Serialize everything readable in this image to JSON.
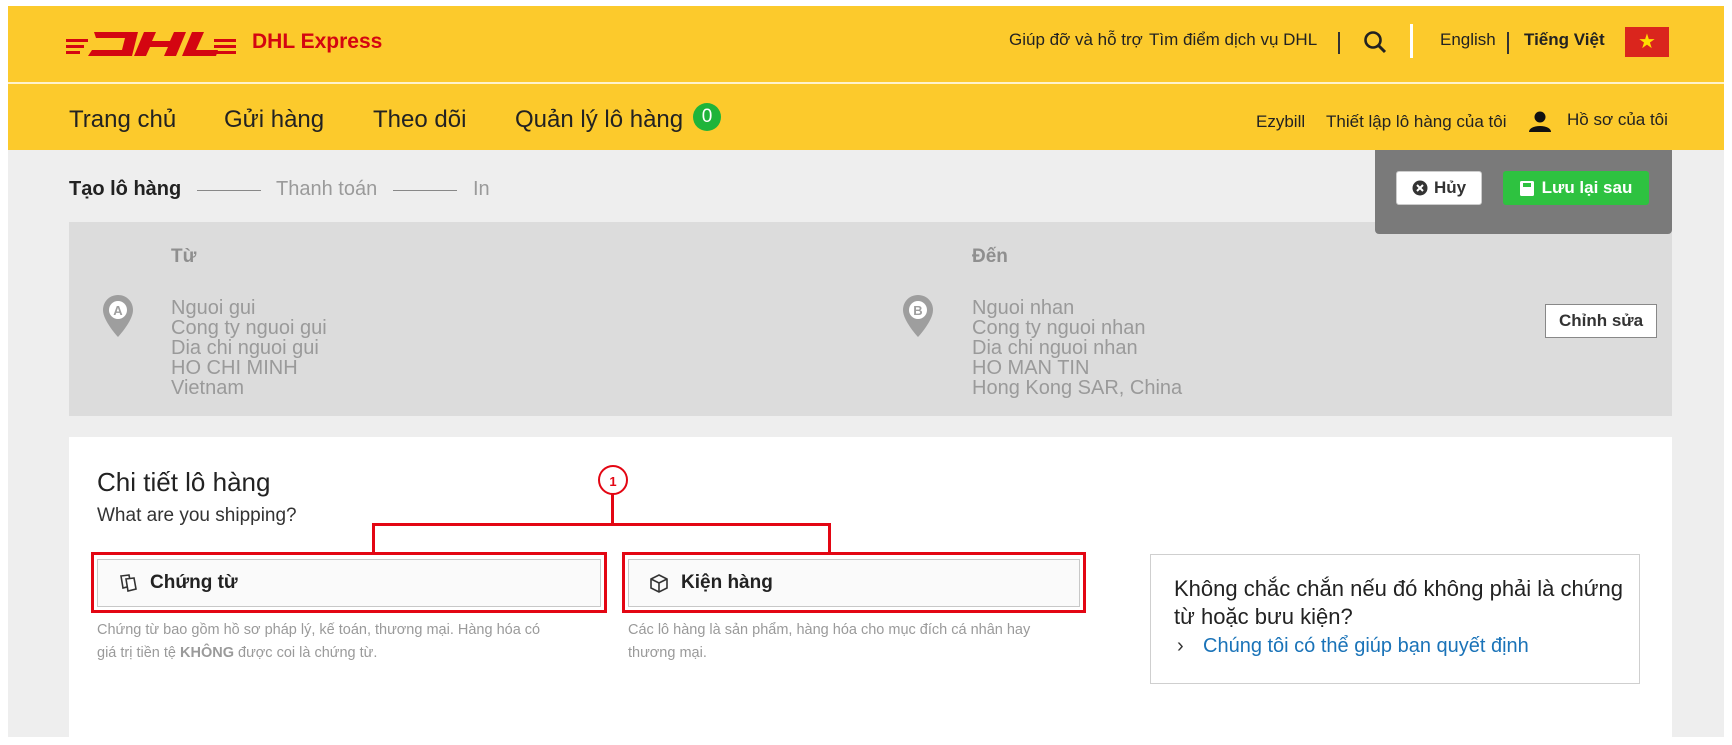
{
  "header": {
    "logo_text": "DHL",
    "brand": "DHL Express",
    "help": "Giúp đỡ và hỗ trợ",
    "find_location": "Tìm điểm dịch vụ DHL",
    "lang_en": "English",
    "lang_vi": "Tiếng Việt",
    "flag_star": "★"
  },
  "nav": {
    "home": "Trang chủ",
    "send": "Gửi hàng",
    "track": "Theo dõi",
    "manage": "Quản lý lô hàng",
    "manage_count": "0",
    "ezybill": "Ezybill",
    "setup": "Thiết lập lô hàng của tôi",
    "profile": "Hồ sơ của tôi"
  },
  "steps": [
    "Tạo lô hàng",
    "Thanh toán",
    "In"
  ],
  "actions": {
    "cancel": "Hủy",
    "save_later": "Lưu lại sau"
  },
  "from": {
    "heading": "Từ",
    "marker": "A",
    "lines": [
      "Nguoi gui",
      "Cong ty nguoi gui",
      "Dia chi nguoi gui",
      "HO CHI MINH",
      "Vietnam"
    ]
  },
  "to": {
    "heading": "Đến",
    "marker": "B",
    "lines": [
      "Nguoi nhan",
      "Cong ty nguoi nhan",
      "Dia chi nguoi nhan",
      "HO MAN TIN",
      "Hong Kong SAR, China"
    ]
  },
  "edit_button": "Chỉnh sửa",
  "details": {
    "title": "Chi tiết lô hàng",
    "subtitle": "What are you shipping?",
    "documents": {
      "label": "Chứng từ",
      "desc_line1": "Chứng từ bao gồm hồ sơ pháp lý, kế toán, thương mại. Hàng hóa có",
      "desc_line2_a": "giá trị tiền tệ ",
      "desc_line2_b": "KHÔNG",
      "desc_line2_c": " được coi là chứng từ."
    },
    "package": {
      "label": "Kiện hàng",
      "desc_line1": "Các lô hàng là sản phẩm, hàng hóa cho mục đích cá nhân hay",
      "desc_line2": "thương mại."
    },
    "help": {
      "title": "Không chắc chắn nếu đó không phải là chứng từ hoặc bưu kiện?",
      "link": "Chúng tôi có thể giúp bạn quyết định",
      "arrow": "›"
    }
  },
  "annotation_marker": "1",
  "colors": {
    "dhl_yellow": "#fcca2c",
    "dhl_red": "#d40511",
    "badge_green": "#1fb43a",
    "save_green": "#2ec240",
    "link_blue": "#1a73b8",
    "annotation_red": "#e30613"
  }
}
